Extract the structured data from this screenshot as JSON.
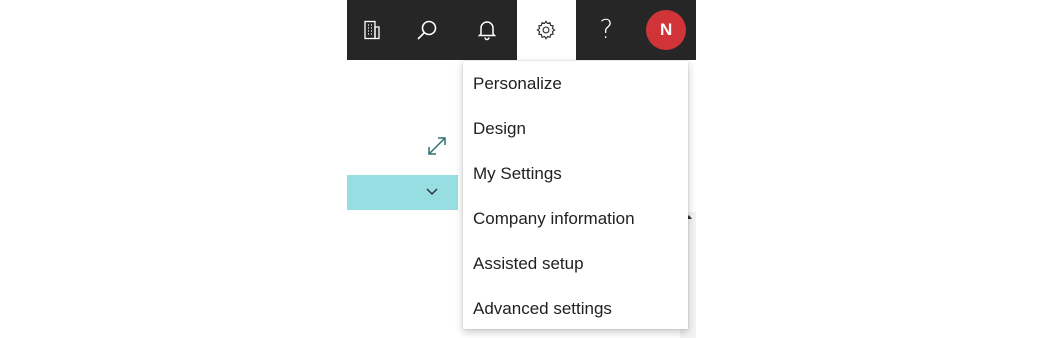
{
  "topbar": {
    "buttons": [
      {
        "icon": "building-icon"
      },
      {
        "icon": "search-icon"
      },
      {
        "icon": "bell-icon"
      },
      {
        "icon": "gear-icon",
        "active": true
      },
      {
        "icon": "help-icon",
        "glyph": "?"
      }
    ],
    "avatar": {
      "initial": "N",
      "color": "#d13438"
    }
  },
  "settings_menu": {
    "items": [
      {
        "label": "Personalize"
      },
      {
        "label": "Design"
      },
      {
        "label": "My Settings"
      },
      {
        "label": "Company information"
      },
      {
        "label": "Assisted setup"
      },
      {
        "label": "Advanced settings"
      }
    ]
  },
  "colors": {
    "topbar_bg": "#262626",
    "accent_teal": "#97dee3",
    "avatar_red": "#d13438",
    "expand_icon": "#2f6f6f"
  }
}
